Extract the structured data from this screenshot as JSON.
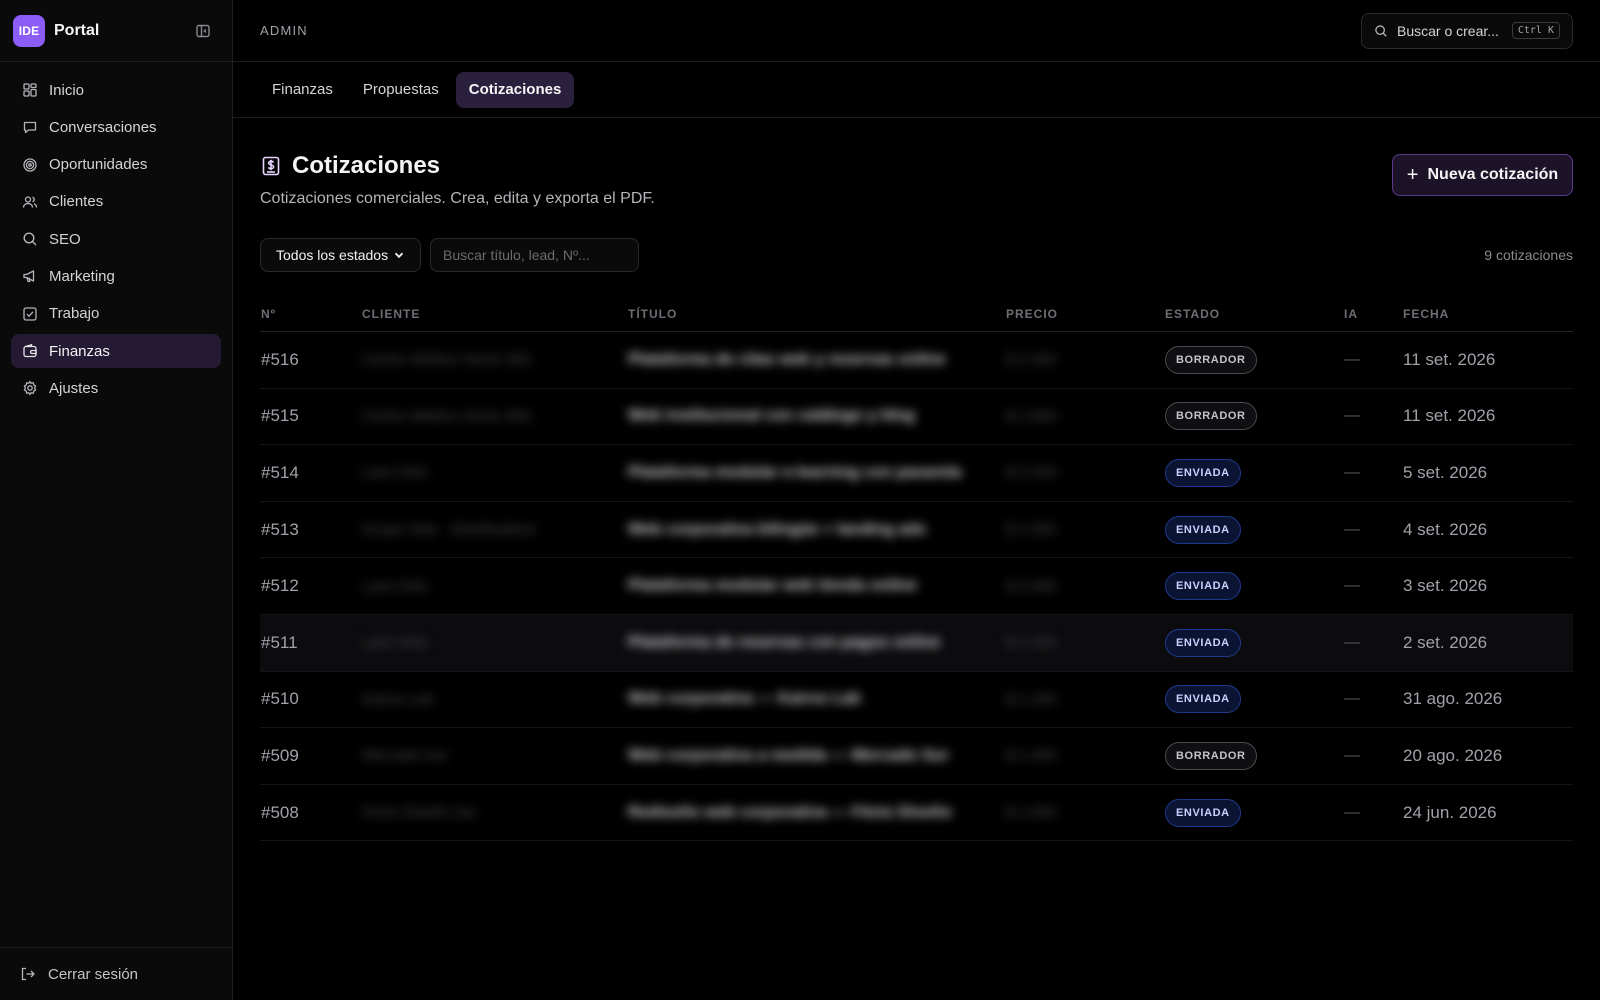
{
  "brand": {
    "logo": "IDE",
    "name": "Portal"
  },
  "sidebar": {
    "items": [
      {
        "label": "Inicio",
        "icon": "grid-icon"
      },
      {
        "label": "Conversaciones",
        "icon": "chat-icon"
      },
      {
        "label": "Oportunidades",
        "icon": "target-icon"
      },
      {
        "label": "Clientes",
        "icon": "users-icon"
      },
      {
        "label": "SEO",
        "icon": "search-icon"
      },
      {
        "label": "Marketing",
        "icon": "megaphone-icon"
      },
      {
        "label": "Trabajo",
        "icon": "checkbox-icon"
      },
      {
        "label": "Finanzas",
        "icon": "wallet-icon",
        "active": true
      },
      {
        "label": "Ajustes",
        "icon": "gear-icon"
      }
    ],
    "logout": "Cerrar sesión"
  },
  "topbar": {
    "section": "ADMIN",
    "search_placeholder": "Buscar o crear...",
    "shortcut": "Ctrl K"
  },
  "tabs": [
    {
      "label": "Finanzas"
    },
    {
      "label": "Propuestas"
    },
    {
      "label": "Cotizaciones",
      "active": true
    }
  ],
  "page": {
    "title": "Cotizaciones",
    "subtitle": "Cotizaciones comerciales. Crea, edita y exporta el PDF.",
    "new_button": "Nueva cotización"
  },
  "filters": {
    "status_selected": "Todos los estados",
    "search_placeholder": "Buscar título, lead, Nº...",
    "count": "9 cotizaciones"
  },
  "table": {
    "columns": [
      "Nº",
      "CLIENTE",
      "TÍTULO",
      "PRECIO",
      "ESTADO",
      "IA",
      "FECHA"
    ],
    "rows": [
      {
        "num": "#516",
        "cliente": "Centro Médico Norte SRL",
        "titulo": "Plataforma de citas web y reservas online",
        "precio": "$ 2.400",
        "estado": "BORRADOR",
        "ia": "—",
        "fecha": "11 set. 2026"
      },
      {
        "num": "#515",
        "cliente": "Centro Médico Norte SRL",
        "titulo": "Web institucional con catálogo y blog",
        "precio": "$ 1.800",
        "estado": "BORRADOR",
        "ia": "—",
        "fecha": "11 set. 2026"
      },
      {
        "num": "#514",
        "cliente": "Lara Ortiz",
        "titulo": "Plataforma modular e-learning con pasarela",
        "precio": "$ 3.200",
        "estado": "ENVIADA",
        "ia": "—",
        "fecha": "5 set. 2026"
      },
      {
        "num": "#513",
        "cliente": "Grupo Vela · Distribuidora",
        "titulo": "Web corporativa bilingüe + landing ads",
        "precio": "$ 1.950",
        "estado": "ENVIADA",
        "ia": "—",
        "fecha": "4 set. 2026"
      },
      {
        "num": "#512",
        "cliente": "Lara Ortiz",
        "titulo": "Plataforma modular web tienda online",
        "precio": "$ 2.600",
        "estado": "ENVIADA",
        "ia": "—",
        "fecha": "3 set. 2026"
      },
      {
        "num": "#511",
        "cliente": "Lara Ortiz",
        "titulo": "Plataforma de reservas con pagos online",
        "precio": "$ 2.100",
        "estado": "ENVIADA",
        "ia": "—",
        "fecha": "2 set. 2026"
      },
      {
        "num": "#510",
        "cliente": "Kairos Lab",
        "titulo": "Web corporativa — Kairos Lab",
        "precio": "$ 1.200",
        "estado": "ENVIADA",
        "ia": "—",
        "fecha": "31 ago. 2026"
      },
      {
        "num": "#509",
        "cliente": "Mercado Sur",
        "titulo": "Web corporativa a medida — Mercado Sur",
        "precio": "$ 1.400",
        "estado": "BORRADOR",
        "ia": "—",
        "fecha": "20 ago. 2026"
      },
      {
        "num": "#508",
        "cliente": "Fénix Diseño Sur",
        "titulo": "Rediseño web corporativa — Fénix Diseño",
        "precio": "$ 1.650",
        "estado": "ENVIADA",
        "ia": "—",
        "fecha": "24 jun. 2026"
      }
    ]
  },
  "colors": {
    "accent": "#8b5cf6",
    "active_bg": "#241a33",
    "badge_sent": "#1e3a8a",
    "badge_draft": "#4a4a50"
  }
}
